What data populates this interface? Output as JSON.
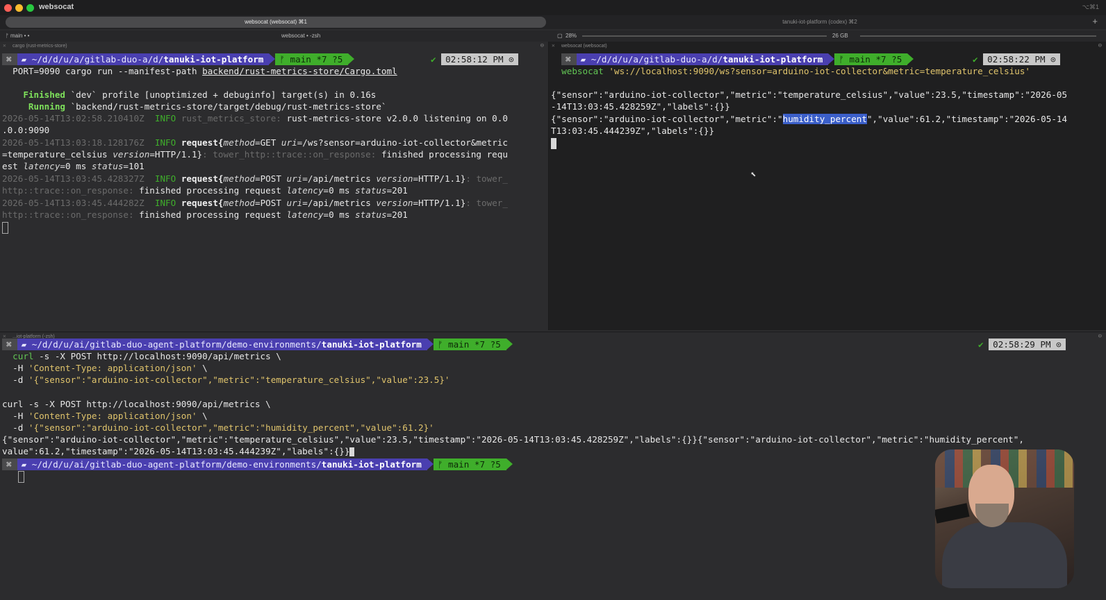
{
  "window": {
    "title": "websocat",
    "shortcut": "⌥⌘1"
  },
  "tabs": [
    {
      "label": "websocat (websocat) ⌘1"
    },
    {
      "label": "tanuki-iot-platform (codex) ⌘2"
    }
  ],
  "statusbar": {
    "branch": "ᚠ main • •",
    "session": "websocat • -zsh",
    "cpu": "28%",
    "mem": "26 GB"
  },
  "colors": {
    "prompt_dir": "#4a3fb0",
    "prompt_git": "#3fae2b",
    "info": "#3fae2b",
    "highlight": "#3b5fc9"
  },
  "pane_top_left": {
    "label": "cargo (rust-metrics-store)",
    "prompt": {
      "dir_prefix": "~/d/d/u/a/gitlab-duo-a/d/",
      "dir_bold": "tanuki-iot-platform",
      "git": "ᚠ main *7 ?5",
      "time": "02:58:12 PM"
    },
    "command_prefix": "PORT=9090 cargo run --manifest-path ",
    "command_path": "backend/rust-metrics-store/Cargo.toml",
    "finished_word": "Finished",
    "finished_rest": " `dev` profile [unoptimized + debuginfo] target(s) in 0.16s",
    "running_word": "Running",
    "running_rest": " `backend/rust-metrics-store/target/debug/rust-metrics-store`",
    "log1_ts": "2026-05-14T13:02:58.210410Z",
    "log1_level": "INFO",
    "log1_target": "rust_metrics_store:",
    "log1_msg": "rust-metrics-store v2.0.0 listening on 0.0",
    "log1_cont": ".0.0:9090",
    "log2_ts": "2026-05-14T13:03:18.128176Z",
    "log2_level": "INFO",
    "log2_request": "request{",
    "log2_method_key": "method",
    "log2_method_val": "=GET ",
    "log2_uri_key": "uri",
    "log2_uri_val": "=/ws?sensor=arduino-iot-collector&metric",
    "log2_cont1a": "=temperature_celsius ",
    "log2_version_key": "version",
    "log2_version_val": "=HTTP/1.1}",
    "log2_cont1b": ": tower_http::trace::on_response:",
    "log2_cont1c": " finished processing requ",
    "log2_cont2a": "est ",
    "log2_latency_key": "latency",
    "log2_latency_val": "=0 ms ",
    "log2_status_key": "status",
    "log2_status_val": "=101",
    "log3_ts": "2026-05-14T13:03:45.428327Z",
    "log3_level": "INFO",
    "log3_request": "request{",
    "log3_method_key": "method",
    "log3_method_val": "=POST ",
    "log3_uri_key": "uri",
    "log3_uri_val": "=/api/metrics ",
    "log3_version_key": "version",
    "log3_version_val": "=HTTP/1.1}",
    "log3_tail": ": tower_",
    "log3_cont_a": "http::trace::on_response:",
    "log3_cont_b": " finished processing request ",
    "log3_latency_key": "latency",
    "log3_latency_val": "=0 ms ",
    "log3_status_key": "status",
    "log3_status_val": "=201",
    "log4_ts": "2026-05-14T13:03:45.444282Z",
    "log4_level": "INFO",
    "log4_request": "request{",
    "log4_method_key": "method",
    "log4_method_val": "=POST ",
    "log4_uri_key": "uri",
    "log4_uri_val": "=/api/metrics ",
    "log4_version_key": "version",
    "log4_version_val": "=HTTP/1.1}",
    "log4_tail": ": tower_",
    "log4_cont_a": "http::trace::on_response:",
    "log4_cont_b": " finished processing request ",
    "log4_latency_key": "latency",
    "log4_latency_val": "=0 ms ",
    "log4_status_key": "status",
    "log4_status_val": "=201"
  },
  "pane_top_right": {
    "label": "websocat (websocat)",
    "prompt": {
      "dir_prefix": "~/d/d/u/a/gitlab-duo-a/d/",
      "dir_bold": "tanuki-iot-platform",
      "git": "ᚠ main *7 ?5",
      "time": "02:58:22 PM"
    },
    "command_word": "websocat",
    "command_arg": " 'ws://localhost:9090/ws?sensor=arduino-iot-collector&metric=temperature_celsius'",
    "out1_a": "{\"sensor\":\"arduino-iot-collector\",\"metric\":\"temperature_celsius\",\"value\":23.5,\"timestamp\":\"2026-05",
    "out1_b": "-14T13:03:45.428259Z\",\"labels\":{}}",
    "out2_pre": "{\"sensor\":\"arduino-iot-collector\",\"metric\":\"",
    "out2_hl": "humidity_percent",
    "out2_post": "\",\"value\":61.2,\"timestamp\":\"2026-05-14",
    "out2_b": "T13:03:45.444239Z\",\"labels\":{}}"
  },
  "pane_bottom": {
    "label": "...iot-platform (-zsh)",
    "prompt": {
      "dir_prefix": "~/d/d/u/ai/gitlab-duo-agent-platform/demo-environments/",
      "dir_bold": "tanuki-iot-platform",
      "git": "ᚠ main *7 ?5",
      "time": "02:58:29 PM"
    },
    "cmd1_line1_word": "curl",
    "cmd1_line1_rest": " -s -X POST http://localhost:9090/api/metrics \\",
    "cmd1_line2_flag": "  -H ",
    "cmd1_line2_str": "'Content-Type: application/json'",
    "cmd1_line2_tail": " \\",
    "cmd1_line3_flag": "  -d ",
    "cmd1_line3_str": "'{\"sensor\":\"arduino-iot-collector\",\"metric\":\"temperature_celsius\",\"value\":23.5}'",
    "cmd2_line1": "curl -s -X POST http://localhost:9090/api/metrics \\",
    "cmd2_line2_flag": "  -H ",
    "cmd2_line2_str": "'Content-Type: application/json'",
    "cmd2_line2_tail": " \\",
    "cmd2_line3_flag": "  -d ",
    "cmd2_line3_str": "'{\"sensor\":\"arduino-iot-collector\",\"metric\":\"humidity_percent\",\"value\":61.2}'",
    "output_line1": "{\"sensor\":\"arduino-iot-collector\",\"metric\":\"temperature_celsius\",\"value\":23.5,\"timestamp\":\"2026-05-14T13:03:45.428259Z\",\"labels\":{}}{\"sensor\":\"arduino-iot-collector\",\"metric\":\"humidity_percent\",",
    "output_line2": "value\":61.2,\"timestamp\":\"2026-05-14T13:03:45.444239Z\",\"labels\":{}}"
  }
}
